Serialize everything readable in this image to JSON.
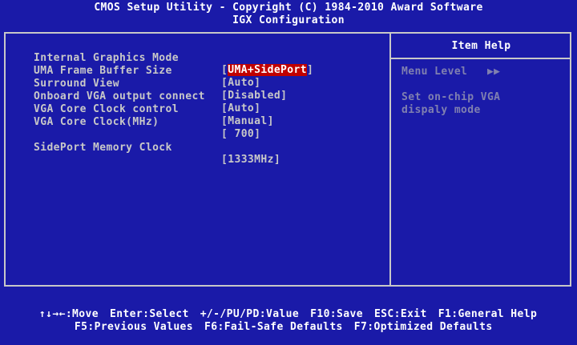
{
  "header": {
    "title": "CMOS Setup Utility - Copyright (C) 1984-2010 Award Software",
    "subtitle": "IGX Configuration"
  },
  "settings": [
    {
      "label": "Internal Graphics Mode",
      "value": "UMA+SidePort",
      "selected": true
    },
    {
      "label": "UMA Frame Buffer Size",
      "value": "Auto"
    },
    {
      "label": "Surround View",
      "value": "Disabled"
    },
    {
      "label": "Onboard VGA output connect",
      "value": "Auto"
    },
    {
      "label": "VGA Core Clock control",
      "value": "Manual"
    },
    {
      "label": "VGA Core Clock(MHz)",
      "value": " 700"
    },
    {
      "label": "SidePort Memory Clock",
      "value": "1333MHz"
    }
  ],
  "help": {
    "title": "Item Help",
    "menu_level": "Menu Level   ▶▶",
    "desc_line1": "Set on-chip VGA",
    "desc_line2": "dispaly mode"
  },
  "footer": {
    "line1": [
      "↑↓→←:Move",
      "Enter:Select",
      "+/-/PU/PD:Value",
      "F10:Save",
      "ESC:Exit",
      "F1:General Help"
    ],
    "line2": [
      "F5:Previous Values",
      "F6:Fail-Safe Defaults",
      "F7:Optimized Defaults"
    ]
  },
  "colors": {
    "background": "#1a1aa8",
    "text": "#c8c8c8",
    "highlight": "#c00000",
    "help_text": "#8080b0"
  }
}
